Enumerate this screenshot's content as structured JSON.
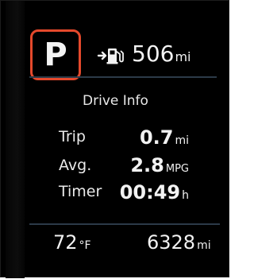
{
  "gear": "P",
  "fuel_range": {
    "value": "506",
    "unit": "mi",
    "icon": "fuel-pump-icon"
  },
  "title": "Drive Info",
  "rows": [
    {
      "label": "Trip",
      "value": "0.7",
      "unit": "mi"
    },
    {
      "label": "Avg.",
      "value": "2.8",
      "unit": "MPG"
    },
    {
      "label": "Timer",
      "value": "00:49",
      "unit": "h"
    }
  ],
  "outside_temp": {
    "value": "72",
    "unit": "°F"
  },
  "odometer": {
    "value": "6328",
    "unit": "mi"
  },
  "colors": {
    "highlight": "#e5492c",
    "divider": "#2c3a48",
    "text": "#f2f2f2",
    "background": "#000000"
  }
}
